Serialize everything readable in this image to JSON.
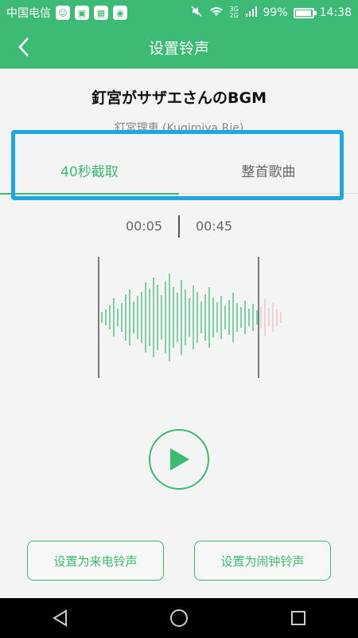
{
  "status_bar": {
    "carrier": "中国电信",
    "battery_percent": "99%",
    "battery_level": 0.99,
    "time": "14:38",
    "network": "3G 2G"
  },
  "header": {
    "title": "设置铃声"
  },
  "song": {
    "title": "釘宮がサザエさんのBGM",
    "artist": "釘宮理恵 (Kugimiya Rie)"
  },
  "tabs": [
    {
      "label": "40秒截取",
      "active": true
    },
    {
      "label": "整首歌曲",
      "active": false
    }
  ],
  "clip": {
    "start": "00:05",
    "end": "00:45"
  },
  "actions": {
    "set_call": "设置为来电铃声",
    "set_alarm": "设置为闹钟铃声"
  },
  "colors": {
    "accent": "#3dba74",
    "highlight": "#1ea6e0"
  }
}
